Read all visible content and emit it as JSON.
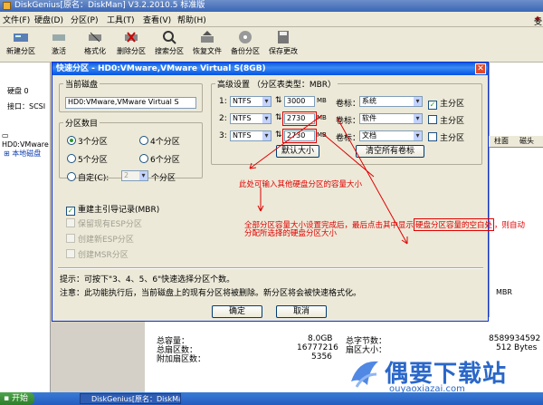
{
  "app": {
    "title": "DiskGenius[原名：DiskMan] V3.2.2010.5 标准版",
    "menu": [
      "文件(F)",
      "硬盘(D)",
      "分区(P)",
      "工具(T)",
      "查看(V)",
      "帮助(H)"
    ],
    "help_user": "受助"
  },
  "toolbar": [
    "新建分区",
    "激活",
    "格式化",
    "删除分区",
    "搜索分区",
    "恢复文件",
    "备份分区",
    "保存更改"
  ],
  "left": {
    "disk_label": "硬盘 0",
    "port_label": "接口：SCSI",
    "tree": [
      "HD0:VMware",
      "本地磁盘"
    ]
  },
  "right_bg": {
    "col_headers": [
      "柱面",
      "磁头"
    ],
    "mbr": "MBR"
  },
  "bottom": {
    "rows": [
      {
        "label": "总容量：",
        "value": "8.0GB",
        "label2": "总字节数：",
        "value2": "8589934592"
      },
      {
        "label": "总扇区数：",
        "value": "16777216",
        "label2": "扇区大小：",
        "value2": "512 Bytes"
      },
      {
        "label": "附加扇区数：",
        "value": "5356",
        "label2": "",
        "value2": ""
      }
    ]
  },
  "taskbar": {
    "start": "开始",
    "item": "DiskGenius[原名：DiskMan..."
  },
  "dialog": {
    "title": "快速分区 - HD0:VMware,VMware Virtual S(8GB)",
    "current_disk_legend": "当前磁盘",
    "current_disk_value": "HD0:VMware,VMware Virtual S",
    "count_legend": "分区数目",
    "count_options": [
      "3个分区",
      "4个分区",
      "5个分区",
      "6个分区"
    ],
    "custom_label": "自定(C):",
    "custom_value": "2",
    "custom_suffix": "个分区",
    "checks": [
      {
        "label": "重建主引导记录(MBR)",
        "checked": true,
        "enabled": true
      },
      {
        "label": "保留现有ESP分区",
        "checked": false,
        "enabled": false
      },
      {
        "label": "创建新ESP分区",
        "checked": false,
        "enabled": false
      },
      {
        "label": "创建MSR分区",
        "checked": false,
        "enabled": false
      }
    ],
    "hint": "提示：可按下\"3、4、5、6\"快速选择分区个数。",
    "note": "注意：此功能执行后，当前磁盘上的现有分区将被删除。新分区将会被快速格式化。",
    "settings_legend": "高级设置 （分区表类型：MBR）",
    "partitions": [
      {
        "index": "1:",
        "fs": "NTFS",
        "size": "3000",
        "unit": "MB",
        "vol_label": "卷标：",
        "volume": "系统",
        "primary": true
      },
      {
        "index": "2:",
        "fs": "NTFS",
        "size": "2730",
        "unit": "MB",
        "vol_label": "卷标：",
        "volume": "软件",
        "primary": false
      },
      {
        "index": "3:",
        "fs": "NTFS",
        "size": "2730",
        "unit": "MB",
        "vol_label": "卷标：",
        "volume": "文档",
        "primary": false
      }
    ],
    "primary_label": "主分区",
    "default_size_button": "默认大小",
    "clear_labels_button": "清空所有卷标",
    "ok_button": "确定",
    "cancel_button": "取消"
  },
  "annotations": {
    "a1": "此处可输入其他硬盘分区的容量大小",
    "a2_line1": "全部分区容量大小设置完成后，最后点击其中显示",
    "a2_box": "硬盘分区容量的空白处",
    "a2_tail": "，则自动",
    "a2_line2": "分配所选择的硬盘分区大小"
  },
  "watermark": {
    "logo": "偶要下载站",
    "url": "ouyaoxiazai.com"
  }
}
